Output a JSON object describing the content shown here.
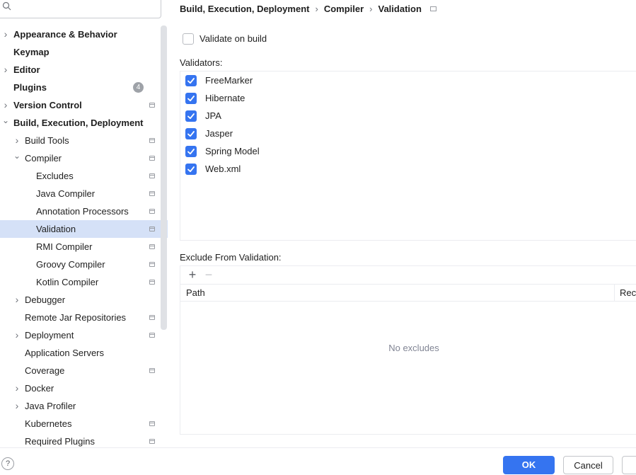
{
  "search": {
    "placeholder": ""
  },
  "sidebar": {
    "items": [
      {
        "label": "Appearance & Behavior",
        "level": 0,
        "bold": true,
        "expander": "collapsed",
        "pin": false
      },
      {
        "label": "Keymap",
        "level": 0,
        "bold": true,
        "expander": "none",
        "pin": false
      },
      {
        "label": "Editor",
        "level": 0,
        "bold": true,
        "expander": "collapsed",
        "pin": false
      },
      {
        "label": "Plugins",
        "level": 0,
        "bold": true,
        "expander": "none",
        "pin": false,
        "badge": "4"
      },
      {
        "label": "Version Control",
        "level": 0,
        "bold": true,
        "expander": "collapsed",
        "pin": true
      },
      {
        "label": "Build, Execution, Deployment",
        "level": 0,
        "bold": true,
        "expander": "expanded",
        "pin": false
      },
      {
        "label": "Build Tools",
        "level": 1,
        "bold": false,
        "expander": "collapsed",
        "pin": true
      },
      {
        "label": "Compiler",
        "level": 1,
        "bold": false,
        "expander": "expanded",
        "pin": true
      },
      {
        "label": "Excludes",
        "level": 2,
        "bold": false,
        "expander": "none",
        "pin": true
      },
      {
        "label": "Java Compiler",
        "level": 2,
        "bold": false,
        "expander": "none",
        "pin": true
      },
      {
        "label": "Annotation Processors",
        "level": 2,
        "bold": false,
        "expander": "none",
        "pin": true
      },
      {
        "label": "Validation",
        "level": 2,
        "bold": false,
        "expander": "none",
        "pin": true,
        "selected": true
      },
      {
        "label": "RMI Compiler",
        "level": 2,
        "bold": false,
        "expander": "none",
        "pin": true
      },
      {
        "label": "Groovy Compiler",
        "level": 2,
        "bold": false,
        "expander": "none",
        "pin": true
      },
      {
        "label": "Kotlin Compiler",
        "level": 2,
        "bold": false,
        "expander": "none",
        "pin": true
      },
      {
        "label": "Debugger",
        "level": 1,
        "bold": false,
        "expander": "collapsed",
        "pin": false
      },
      {
        "label": "Remote Jar Repositories",
        "level": 1,
        "bold": false,
        "expander": "none",
        "pin": true
      },
      {
        "label": "Deployment",
        "level": 1,
        "bold": false,
        "expander": "collapsed",
        "pin": true
      },
      {
        "label": "Application Servers",
        "level": 1,
        "bold": false,
        "expander": "none",
        "pin": false
      },
      {
        "label": "Coverage",
        "level": 1,
        "bold": false,
        "expander": "none",
        "pin": true
      },
      {
        "label": "Docker",
        "level": 1,
        "bold": false,
        "expander": "collapsed",
        "pin": false
      },
      {
        "label": "Java Profiler",
        "level": 1,
        "bold": false,
        "expander": "collapsed",
        "pin": false
      },
      {
        "label": "Kubernetes",
        "level": 1,
        "bold": false,
        "expander": "none",
        "pin": true
      },
      {
        "label": "Required Plugins",
        "level": 1,
        "bold": false,
        "expander": "none",
        "pin": true
      }
    ]
  },
  "breadcrumb": [
    "Build, Execution, Deployment",
    "Compiler",
    "Validation"
  ],
  "validate_on_build": {
    "label": "Validate on build",
    "checked": false
  },
  "validators": {
    "label": "Validators:",
    "items": [
      {
        "label": "FreeMarker",
        "checked": true
      },
      {
        "label": "Hibernate",
        "checked": true
      },
      {
        "label": "JPA",
        "checked": true
      },
      {
        "label": "Jasper",
        "checked": true
      },
      {
        "label": "Spring Model",
        "checked": true
      },
      {
        "label": "Web.xml",
        "checked": true
      }
    ]
  },
  "exclude": {
    "label": "Exclude From Validation:",
    "add_icon": "+",
    "remove_icon": "−",
    "columns": [
      "Path",
      "Rec"
    ],
    "empty_text": "No excludes"
  },
  "footer": {
    "help": "?",
    "ok": "OK",
    "cancel": "Cancel"
  },
  "colors": {
    "accent": "#3574f0",
    "selection": "#d5e1f7"
  }
}
